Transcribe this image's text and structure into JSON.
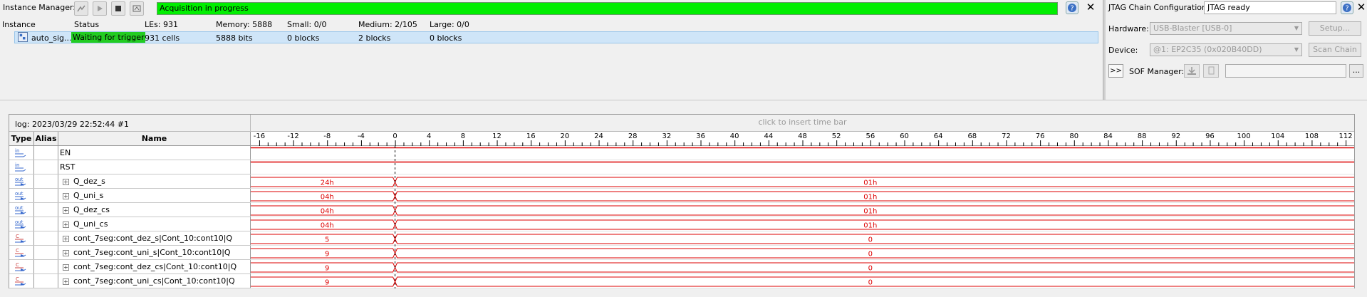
{
  "instance_manager": {
    "title": "Instance Manager:",
    "acquisition_status": "Acquisition in progress",
    "columns": {
      "instance": "Instance",
      "status": "Status",
      "les": "LEs: 931",
      "memory": "Memory: 5888",
      "small": "Small: 0/0",
      "medium": "Medium: 2/105",
      "large": "Large: 0/0"
    },
    "row": {
      "instance": "auto_sig...",
      "status": "Waiting for trigger",
      "les": "931 cells",
      "memory": "5888 bits",
      "small": "0 blocks",
      "medium": "2 blocks",
      "large": "0 blocks"
    },
    "colors": {
      "running": "#00ee00",
      "status": "#22cc22"
    }
  },
  "jtag": {
    "title": "JTAG Chain Configuration:",
    "status": "JTAG ready",
    "hardware_label": "Hardware:",
    "hardware_value": "USB-Blaster [USB-0]",
    "setup_button": "Setup...",
    "device_label": "Device:",
    "device_value": "@1: EP2C35 (0x020B40DD)",
    "scan_button": "Scan Chain",
    "expand_button": ">>",
    "sof_label": "SOF Manager:",
    "browse_button": "..."
  },
  "waveform": {
    "log_label": "log: 2023/03/29 22:52:44  #1",
    "insert_hint": "click to insert time bar",
    "headers": {
      "type": "Type",
      "alias": "Alias",
      "name": "Name"
    },
    "ruler_ticks": [
      "-16",
      "-12",
      "-8",
      "-4",
      "0",
      "4",
      "8",
      "12",
      "16",
      "20",
      "24",
      "28",
      "32",
      "36",
      "40",
      "44",
      "48",
      "52",
      "56",
      "60",
      "64",
      "68",
      "72",
      "76",
      "80",
      "84",
      "88",
      "92",
      "96",
      "100",
      "104",
      "108",
      "112"
    ],
    "trigger_position": 0,
    "signals": [
      {
        "type": "in",
        "name": "EN",
        "expandable": false,
        "level": 1
      },
      {
        "type": "in",
        "name": "RST",
        "expandable": false,
        "level": 1
      },
      {
        "type": "out",
        "name": "Q_dez_s",
        "expandable": true,
        "before": "24h",
        "after": "01h"
      },
      {
        "type": "out",
        "name": "Q_uni_s",
        "expandable": true,
        "before": "04h",
        "after": "01h"
      },
      {
        "type": "out",
        "name": "Q_dez_cs",
        "expandable": true,
        "before": "04h",
        "after": "01h"
      },
      {
        "type": "out",
        "name": "Q_uni_cs",
        "expandable": true,
        "before": "04h",
        "after": "01h"
      },
      {
        "type": "comb",
        "name": "cont_7seg:cont_dez_s|Cont_10:cont10|Q",
        "expandable": true,
        "before": "5",
        "after": "0"
      },
      {
        "type": "comb",
        "name": "cont_7seg:cont_uni_s|Cont_10:cont10|Q",
        "expandable": true,
        "before": "9",
        "after": "0"
      },
      {
        "type": "comb",
        "name": "cont_7seg:cont_dez_cs|Cont_10:cont10|Q",
        "expandable": true,
        "before": "9",
        "after": "0"
      },
      {
        "type": "comb",
        "name": "cont_7seg:cont_uni_cs|Cont_10:cont10|Q",
        "expandable": true,
        "before": "9",
        "after": "0"
      }
    ],
    "colors": {
      "wave": "#dd0000",
      "trigger": "#000000"
    }
  }
}
